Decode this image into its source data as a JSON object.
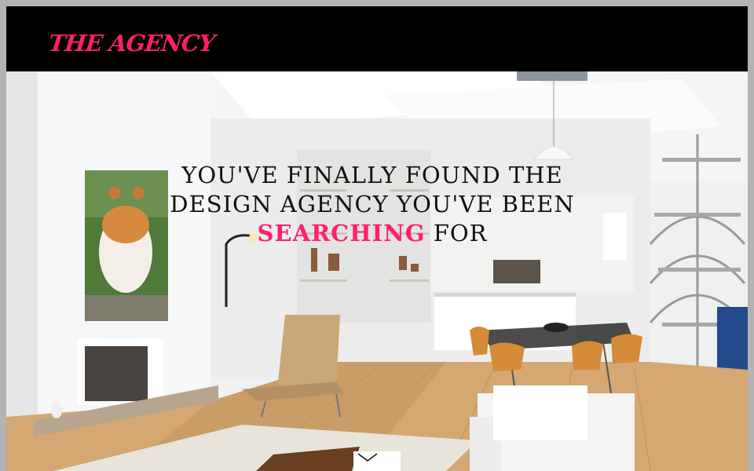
{
  "header": {
    "logo_text": "THE AGENCY",
    "brand_color": "#ff1f6b"
  },
  "hero": {
    "headline_before": "YOU'VE FINALLY FOUND THE DESIGN AGENCY YOU'VE BEEN",
    "headline_accent": "SEARCHING",
    "headline_after": "FOR",
    "accent_color": "#ff1f6b",
    "background_image": "loft-interior-photo",
    "scroll_icon": "chevron-down-icon"
  }
}
